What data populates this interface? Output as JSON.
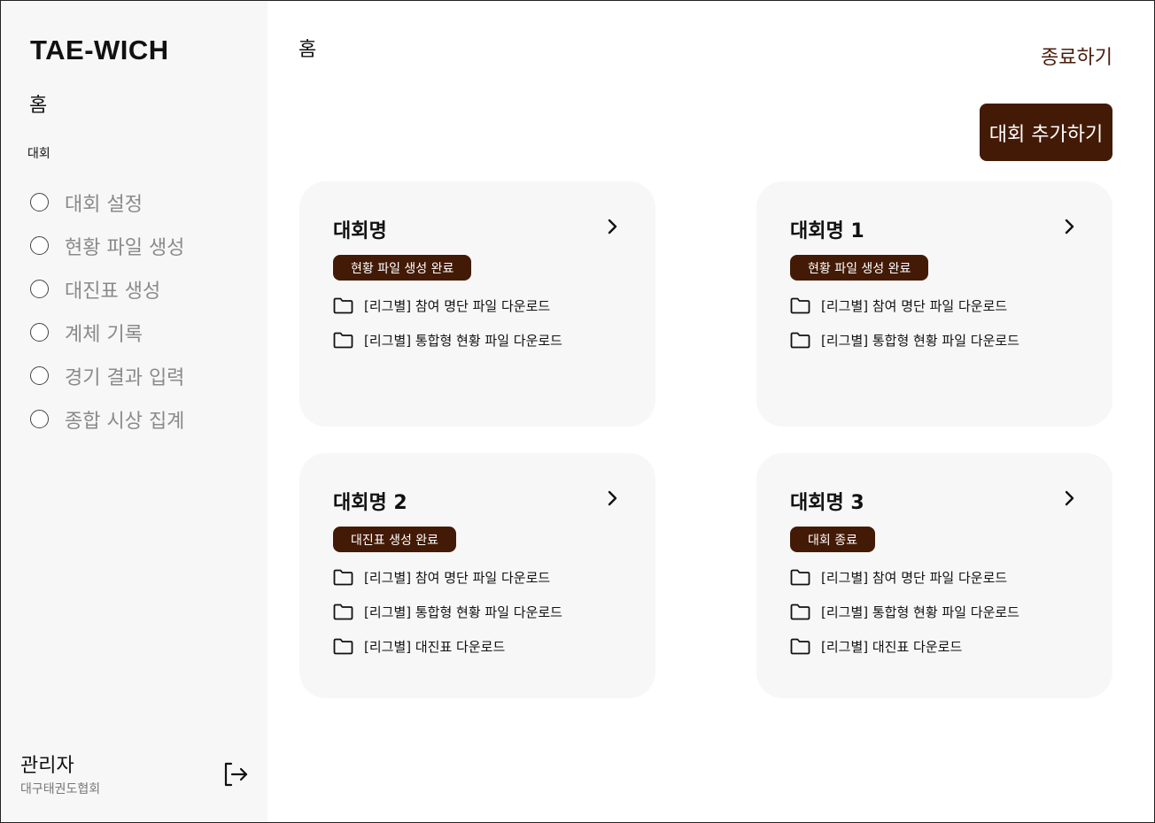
{
  "sidebar": {
    "logo": "TAE-WICH",
    "home": "홈",
    "section": "대회",
    "items": [
      {
        "label": "대회 설정"
      },
      {
        "label": "현황 파일 생성"
      },
      {
        "label": "대진표 생성"
      },
      {
        "label": "계체 기록"
      },
      {
        "label": "경기 결과 입력"
      },
      {
        "label": "종합 시상 집계"
      }
    ],
    "user_name": "관리자",
    "user_org": "대구태권도협회",
    "logout_icon": "logout-icon"
  },
  "header": {
    "title": "홈",
    "exit_label": "종료하기",
    "add_label": "대회 추가하기"
  },
  "cards": [
    {
      "title": "대회명",
      "badge": "현황 파일 생성 완료",
      "files": [
        "[리그별] 참여 명단 파일 다운로드",
        "[리그별] 통합형 현황 파일 다운로드"
      ]
    },
    {
      "title": "대회명 1",
      "badge": "현황 파일 생성 완료",
      "files": [
        "[리그별] 참여 명단 파일 다운로드",
        "[리그별] 통합형 현황 파일 다운로드"
      ]
    },
    {
      "title": "대회명 2",
      "badge": "대진표 생성 완료",
      "files": [
        "[리그별] 참여 명단 파일 다운로드",
        "[리그별] 통합형 현황 파일 다운로드",
        "[리그별] 대진표 다운로드"
      ]
    },
    {
      "title": "대회명 3",
      "badge": "대회 종료",
      "files": [
        "[리그별] 참여 명단 파일 다운로드",
        "[리그별] 통합형 현황 파일 다운로드",
        "[리그별] 대진표 다운로드"
      ]
    }
  ],
  "colors": {
    "accent": "#431a05",
    "exit_text": "#4a1c0c",
    "sidebar_bg": "#f7f7f7",
    "muted": "#8a8a8a"
  }
}
